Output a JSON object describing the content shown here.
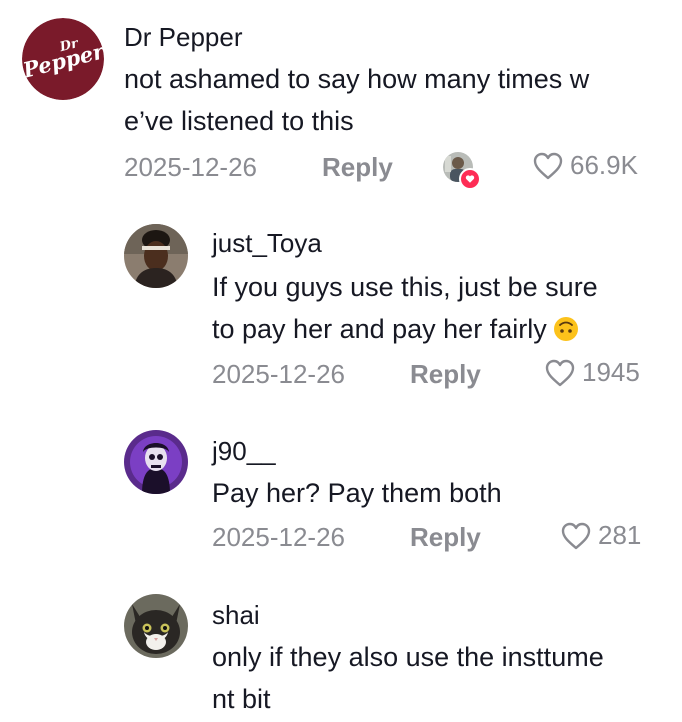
{
  "comments": [
    {
      "username": "Dr Pepper",
      "avatar_logo_text": "Dr Pepper",
      "text": "not ashamed to say how many times w\ne’ve listened to this",
      "date": "2025-12-26",
      "reply_label": "Reply",
      "likes": "66.9K",
      "creator_liked": true
    },
    {
      "username": "just_Toya",
      "text_line1": "If you guys use this, just be sure",
      "text_line2": "to pay her and pay her fairly",
      "emoji": "upside-down-face",
      "date": "2025-12-26",
      "reply_label": "Reply",
      "likes": "1945"
    },
    {
      "username": "j90__",
      "text": "Pay her? Pay them both",
      "date": "2025-12-26",
      "reply_label": "Reply",
      "likes": "281"
    },
    {
      "username": "shai",
      "text": "only if they also use the insttume\nnt bit"
    }
  ],
  "colors": {
    "text": "#161823",
    "muted": "#8a8b91",
    "dr_pepper_red": "#7a1a2a",
    "like_badge": "#fe2c55"
  }
}
